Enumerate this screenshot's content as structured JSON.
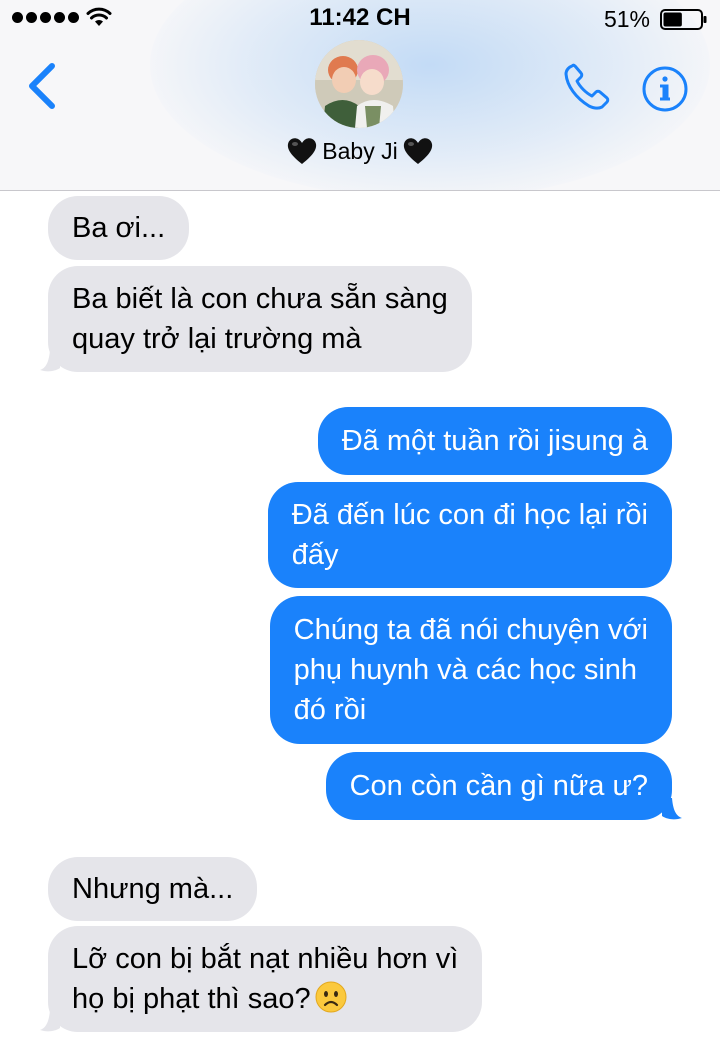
{
  "status_bar": {
    "time": "11:42 CH",
    "battery_percent": "51%",
    "battery_level": 0.51,
    "signal_dots": 5
  },
  "header": {
    "contact_name": "Baby Ji",
    "name_decoration_icon": "black-heart-emoji",
    "back_icon": "chevron-left-icon",
    "call_icon": "phone-icon",
    "info_icon": "info-icon",
    "accent_color": "#1a82fb"
  },
  "messages": [
    {
      "side": "in",
      "lines": [
        "Ba ơi..."
      ]
    },
    {
      "side": "in",
      "lines": [
        "Ba biết là con chưa sẵn sàng",
        "quay trở lại trường mà"
      ]
    },
    {
      "side": "out",
      "lines": [
        "Đã một tuần rồi jisung à"
      ]
    },
    {
      "side": "out",
      "lines": [
        "Đã đến lúc con đi học lại rồi",
        "đấy"
      ]
    },
    {
      "side": "out",
      "lines": [
        "Chúng ta đã nói chuyện với",
        "phụ huynh và các học sinh",
        "đó rồi"
      ]
    },
    {
      "side": "out",
      "lines": [
        "Con còn cần gì nữa ư?"
      ]
    },
    {
      "side": "in",
      "lines": [
        "Nhưng mà..."
      ]
    },
    {
      "side": "in",
      "lines": [
        "Lỡ con bị bắt nạt nhiều hơn vì",
        "họ bị phạt thì sao?"
      ],
      "trailing_emoji": "frowning-face-emoji"
    }
  ],
  "colors": {
    "incoming_bubble": "#e5e5ea",
    "outgoing_bubble": "#1a82fb"
  }
}
